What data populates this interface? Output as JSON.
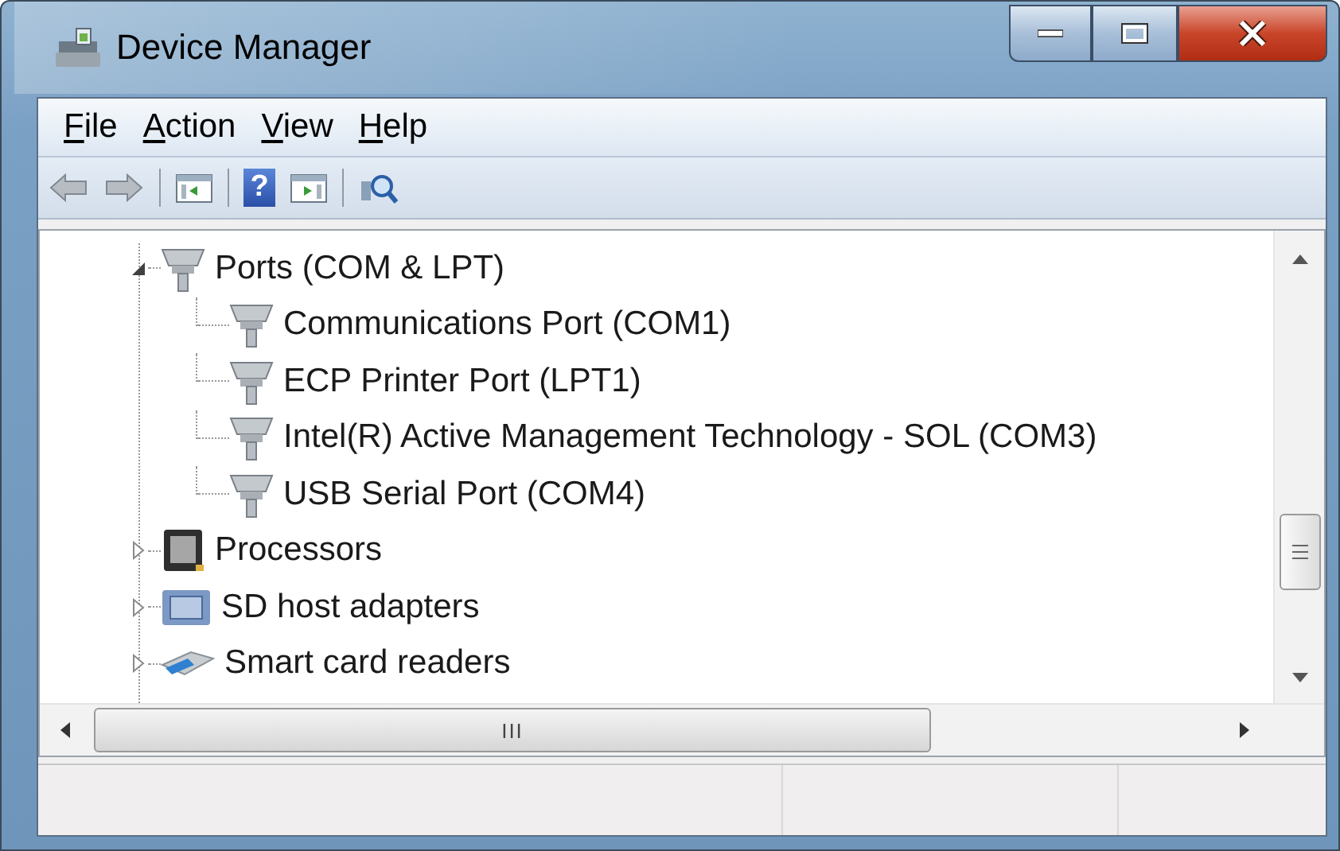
{
  "window": {
    "title": "Device Manager"
  },
  "menu": [
    {
      "accel": "F",
      "rest": "ile"
    },
    {
      "accel": "A",
      "rest": "ction"
    },
    {
      "accel": "V",
      "rest": "iew"
    },
    {
      "accel": "H",
      "rest": "elp"
    }
  ],
  "toolbar": [
    {
      "kind": "back"
    },
    {
      "kind": "forward"
    },
    {
      "kind": "separator"
    },
    {
      "kind": "console-tree"
    },
    {
      "kind": "separator"
    },
    {
      "kind": "help",
      "glyph": "?"
    },
    {
      "kind": "action-pane"
    },
    {
      "kind": "separator"
    },
    {
      "kind": "scan"
    }
  ],
  "tree": [
    {
      "label": "Ports (COM & LPT)",
      "kind": "port",
      "expanded": true,
      "children": [
        {
          "label": "Communications Port (COM1)",
          "kind": "port"
        },
        {
          "label": "ECP Printer Port (LPT1)",
          "kind": "port"
        },
        {
          "label": "Intel(R) Active Management Technology - SOL (COM3)",
          "kind": "port"
        },
        {
          "label": "USB Serial Port (COM4)",
          "kind": "port"
        }
      ]
    },
    {
      "label": "Processors",
      "kind": "processor",
      "expanded": false
    },
    {
      "label": "SD host adapters",
      "kind": "sd-adapter",
      "expanded": false
    },
    {
      "label": "Smart card readers",
      "kind": "card-reader",
      "expanded": false
    }
  ],
  "horizontal_scrollbar": {
    "grip": "III"
  }
}
